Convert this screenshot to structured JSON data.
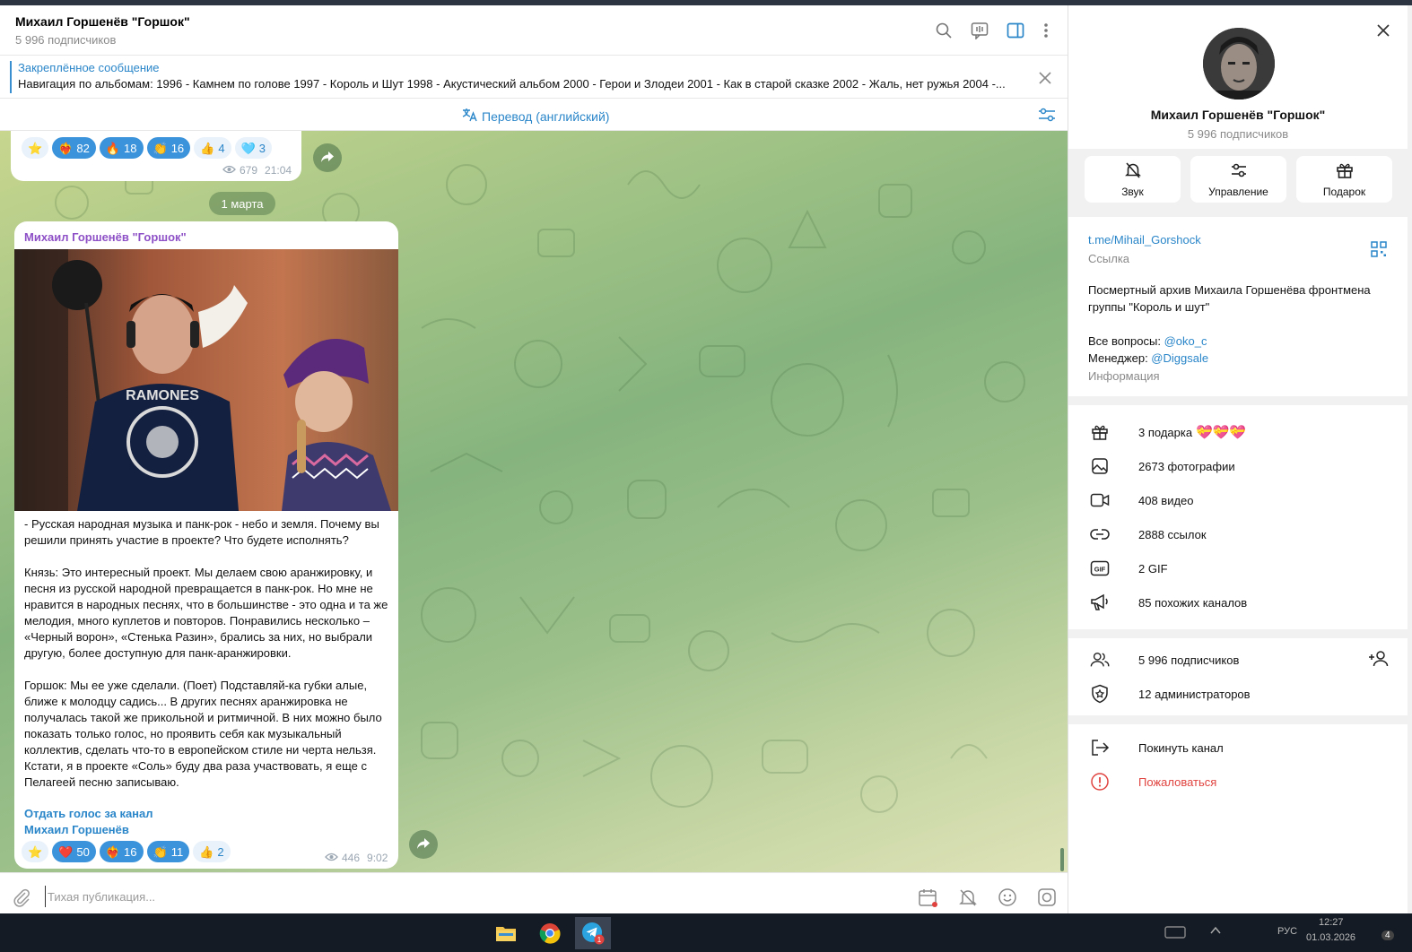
{
  "chat": {
    "title": "Михаил Горшенёв \"Горшок\"",
    "subtitle": "5 996 подписчиков",
    "header_icons": [
      "search-icon",
      "live-stream-icon",
      "sidebar-toggle-icon",
      "more-vertical-icon"
    ],
    "pinned": {
      "title": "Закреплённое сообщение",
      "text": "Навигация по альбомам:  1996 - Камнем по голове 1997 - Король и Шут 1998 - Акустический альбом 2000 - Герои и Злодеи 2001 - Как в старой сказке 2002 - Жаль, нет ружья 2004 -..."
    },
    "translate_label": "Перевод (английский)",
    "date_chip": "1 марта",
    "prev_message": {
      "reactions": [
        {
          "emoji": "⭐",
          "count": ""
        },
        {
          "emoji": "❤️‍🔥",
          "count": "82"
        },
        {
          "emoji": "🔥",
          "count": "18"
        },
        {
          "emoji": "👏",
          "count": "16"
        },
        {
          "emoji": "👍",
          "count": "4"
        },
        {
          "emoji": "🩵",
          "count": "3"
        }
      ],
      "views": "679",
      "time": "21:04"
    },
    "message": {
      "author": "Михаил Горшенёв \"Горшок\"",
      "text": "- Русская народная музыка и панк-рок - небо и земля. Почему вы решили принять участие в проекте? Что будете исполнять?\n\nКнязь: Это интересный проект. Мы делаем свою аранжировку, и песня из русской народной превращается в панк-рок. Но мне не нравится в народных песнях, что в большинстве - это одна и та же мелодия, много куплетов и повторов. Понравились несколько – «Черный ворон», «Стенька Разин», брались за них, но выбрали другую, более доступную для панк-аранжировки.\n\nГоршок: Мы ее уже сделали. (Поет) Подставляй-ка губки алые, ближе к молодцу садись... В других песнях аранжировка не получалась такой же прикольной и ритмичной. В них можно было показать только голос, но проявить себя как музыкальный коллектив, сделать что-то в европейском стиле ни черта нельзя. Кстати, я в проекте «Соль» буду два раза участвовать, я еще с Пелагеей песню записываю.",
      "link1": "Отдать голос за канал",
      "link2": "Михаил Горшенёв",
      "reactions": [
        {
          "emoji": "⭐",
          "count": ""
        },
        {
          "emoji": "❤️",
          "count": "50"
        },
        {
          "emoji": "❤️‍🔥",
          "count": "16"
        },
        {
          "emoji": "👏",
          "count": "11"
        },
        {
          "emoji": "👍",
          "count": "2"
        }
      ],
      "views": "446",
      "time": "9:02"
    },
    "input_placeholder": "Тихая публикация..."
  },
  "side": {
    "title": "Михаил Горшенёв \"Горшок\"",
    "subtitle": "5 996 подписчиков",
    "actions": [
      {
        "label": "Звук",
        "icon": "bell-off-icon"
      },
      {
        "label": "Управление",
        "icon": "sliders-icon"
      },
      {
        "label": "Подарок",
        "icon": "gift-icon"
      }
    ],
    "link": "t.me/Mihail_Gorshock",
    "link_caption": "Ссылка",
    "description": "Посмертный архив  Михаила Горшенёва фронтмена группы \"Король и шут\"",
    "questions_label": "Все вопросы: ",
    "questions_handle": "@oko_c",
    "manager_label": "Менеджер: ",
    "manager_handle": "@Diggsale",
    "info_caption": "Информация",
    "media": [
      {
        "label": "3 подарка",
        "icon": "gift-icon"
      },
      {
        "label": "2673 фотографии",
        "icon": "photo-icon"
      },
      {
        "label": "408 видео",
        "icon": "video-icon"
      },
      {
        "label": "2888 ссылок",
        "icon": "link-icon"
      },
      {
        "label": "2 GIF",
        "icon": "gif-icon"
      },
      {
        "label": "85 похожих каналов",
        "icon": "megaphone-icon"
      }
    ],
    "members": [
      {
        "label": "5 996 подписчиков",
        "icon": "users-icon"
      },
      {
        "label": "12 администраторов",
        "icon": "shield-icon"
      }
    ],
    "leave": "Покинуть канал",
    "report": "Пожаловаться"
  },
  "taskbar": {
    "apps": [
      "file-explorer-icon",
      "chrome-icon",
      "telegram-icon"
    ],
    "telegram_badge": "1",
    "lang": "РУС",
    "time": "12:27",
    "date": "01.03.2026",
    "notifications": "4"
  },
  "colors": {
    "accent": "#2a86c9",
    "reaction_blue": "#3b93db",
    "author_purple": "#8e50c6",
    "danger": "#e0433f"
  }
}
